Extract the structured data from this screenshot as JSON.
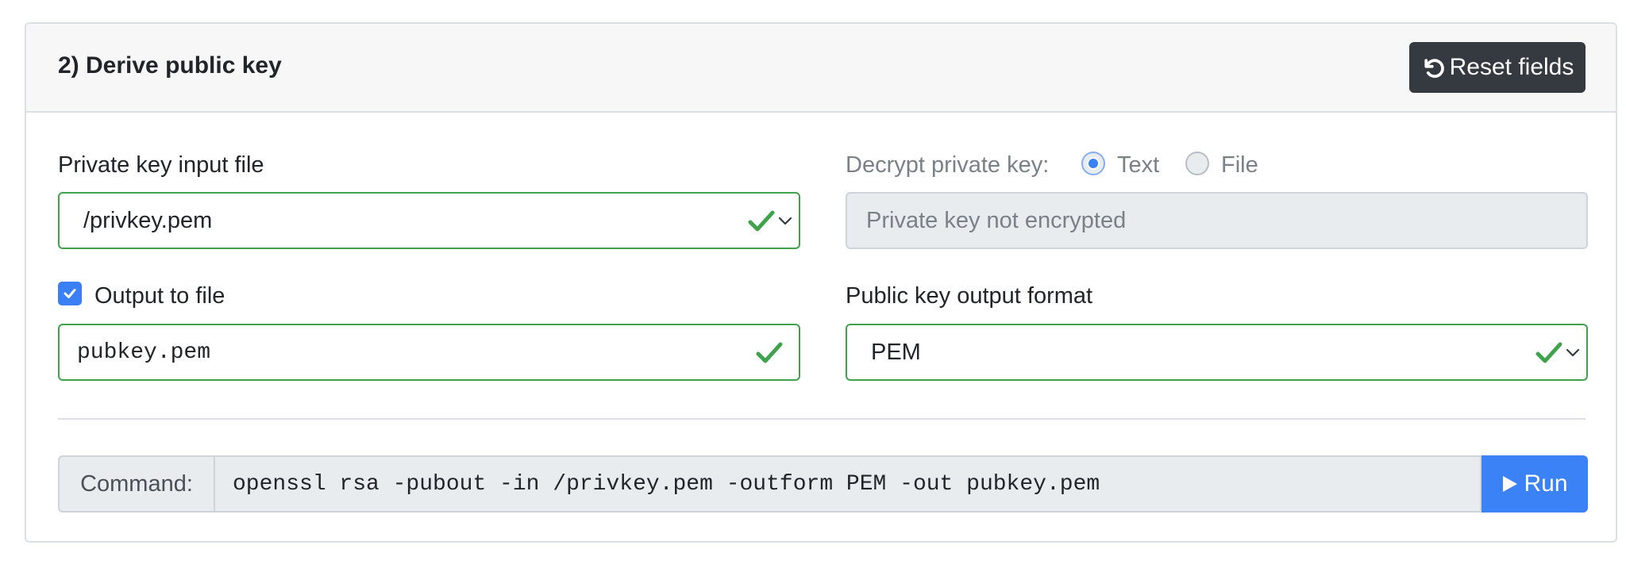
{
  "header": {
    "title": "2) Derive public key",
    "reset_label": "Reset fields"
  },
  "private_key": {
    "label": "Private key input file",
    "selected": "/privkey.pem"
  },
  "decrypt": {
    "label": "Decrypt private key:",
    "options": [
      "Text",
      "File"
    ],
    "selected": "Text",
    "input_placeholder": "Private key not encrypted"
  },
  "output": {
    "checkbox_label": "Output to file",
    "checked": true,
    "filename": "pubkey.pem"
  },
  "format": {
    "label": "Public key output format",
    "selected": "PEM"
  },
  "command": {
    "prefix": "Command:",
    "text": "openssl rsa -pubout -in /privkey.pem -outform PEM -out pubkey.pem",
    "run_label": "Run"
  },
  "colors": {
    "valid_green": "#3fa34d",
    "primary_blue": "#3b82f6",
    "dark_button": "#343a40"
  }
}
